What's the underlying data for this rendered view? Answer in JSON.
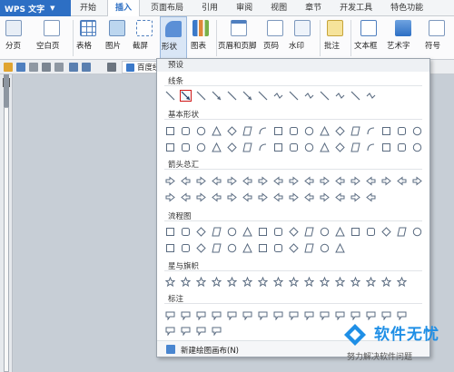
{
  "app": {
    "name": "WPS 文字"
  },
  "tabs": [
    "开始",
    "插入",
    "页面布局",
    "引用",
    "审阅",
    "视图",
    "章节",
    "开发工具",
    "特色功能"
  ],
  "active_tab": "插入",
  "ribbon": {
    "page_break": "分页",
    "blank_page": "空白页",
    "table": "表格",
    "picture": "图片",
    "screenshot": "截屏",
    "shapes": "形状",
    "chart": "图表",
    "header_footer": "页眉和页脚",
    "page_number": "页码",
    "watermark": "水印",
    "comment": "批注",
    "textbox": "文本框",
    "wordart": "艺术字",
    "symbol": "符号"
  },
  "document_tab": {
    "label": "百度经"
  },
  "dropdown": {
    "header": "预设",
    "sections": [
      "线条",
      "基本形状",
      "箭头总汇",
      "流程图",
      "星与旗帜",
      "标注"
    ],
    "footer_label": "新建绘图画布(N)"
  },
  "watermark": {
    "title": "软件无忧",
    "subtitle": "努力解决软件问题"
  },
  "colors": {
    "accent": "#2d6fc4",
    "selection": "#d11a1a"
  }
}
